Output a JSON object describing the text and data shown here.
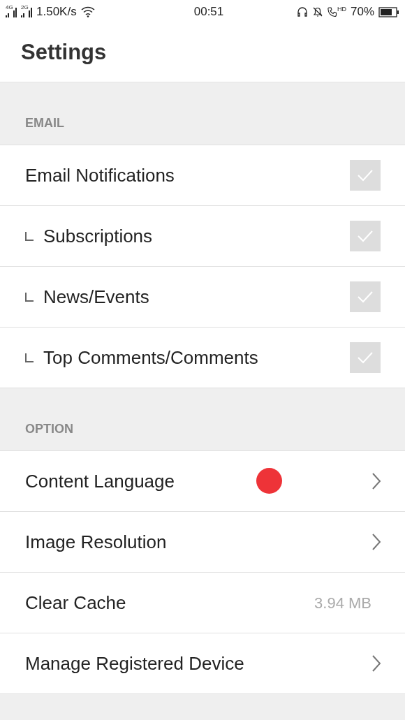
{
  "status_bar": {
    "network_1": "4G",
    "network_2": "2G",
    "speed": "1.50K/s",
    "time": "00:51",
    "call_badge": "HD",
    "battery": "70%"
  },
  "title": "Settings",
  "sections": [
    {
      "header": "EMAIL",
      "items": [
        {
          "kind": "checkbox",
          "label": "Email Notifications",
          "sub": false,
          "checked": true
        },
        {
          "kind": "checkbox",
          "label": "Subscriptions",
          "sub": true,
          "checked": true
        },
        {
          "kind": "checkbox",
          "label": "News/Events",
          "sub": true,
          "checked": true
        },
        {
          "kind": "checkbox",
          "label": "Top Comments/Comments",
          "sub": true,
          "checked": true
        }
      ]
    },
    {
      "header": "OPTION",
      "items": [
        {
          "kind": "link",
          "label": "Content Language",
          "touch_marker": true
        },
        {
          "kind": "link",
          "label": "Image Resolution"
        },
        {
          "kind": "value",
          "label": "Clear Cache",
          "value": "3.94 MB"
        },
        {
          "kind": "link",
          "label": "Manage Registered Device"
        }
      ]
    }
  ]
}
